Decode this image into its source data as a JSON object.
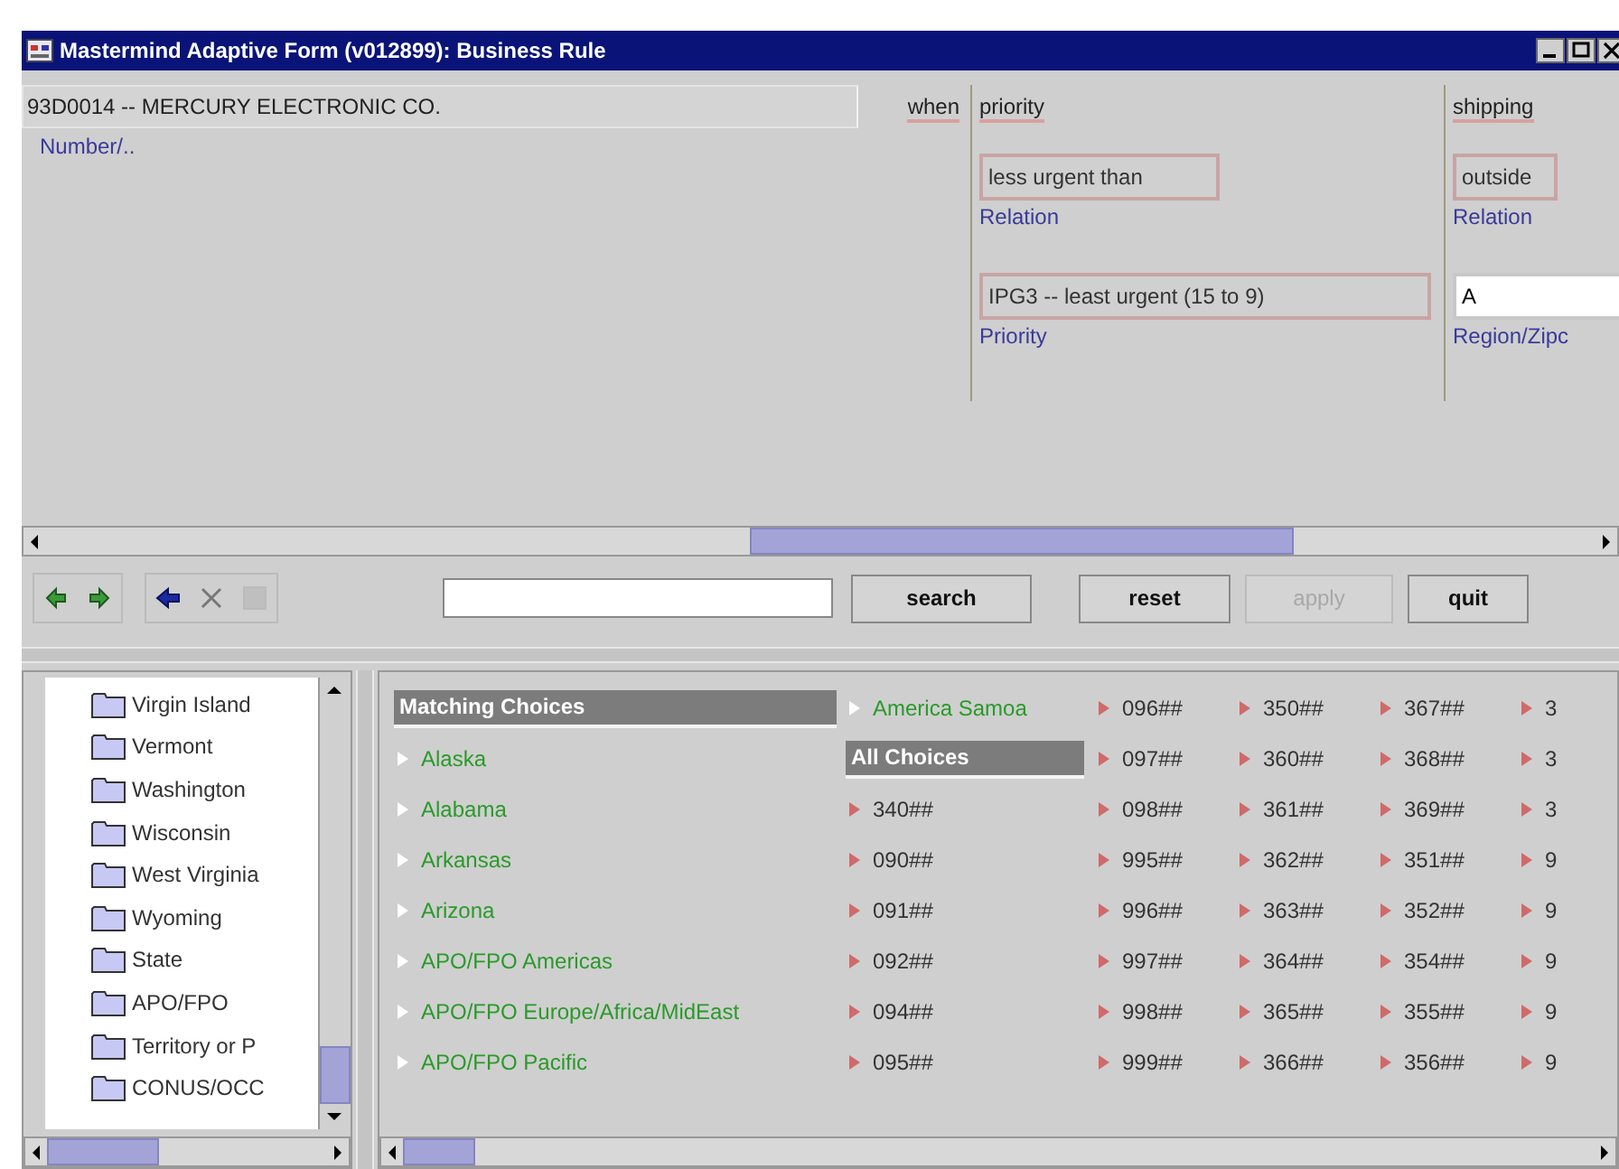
{
  "window": {
    "title": "Mastermind Adaptive Form (v012899): Business Rule"
  },
  "customer": {
    "value": "93D0014 -- MERCURY ELECTRONIC CO.",
    "label": "Number/.."
  },
  "when_label": "when",
  "criteria": [
    {
      "heading": "priority",
      "fields": [
        {
          "value": "less urgent than",
          "label": "Relation",
          "editable": false
        },
        {
          "value": "IPG3 -- least urgent (15 to 9)",
          "label": "Priority",
          "editable": false
        }
      ]
    },
    {
      "heading": "shipping",
      "fields": [
        {
          "value": "outside",
          "label": "Relation",
          "editable": false
        },
        {
          "value": "A",
          "label": "Region/Zipc",
          "editable": true
        }
      ]
    }
  ],
  "toolbar": [
    {
      "kind": "back",
      "disabled": false
    },
    {
      "kind": "forward",
      "disabled": false
    },
    {
      "kind": "left",
      "disabled": false
    },
    {
      "kind": "delete",
      "disabled": false
    },
    {
      "kind": "square",
      "disabled": true
    }
  ],
  "buttons": [
    {
      "label": "search",
      "disabled": false
    },
    {
      "label": "reset",
      "disabled": false
    },
    {
      "label": "apply",
      "disabled": true
    },
    {
      "label": "quit",
      "disabled": false
    }
  ],
  "tree": {
    "items": [
      "Virgin Island",
      "Vermont",
      "Washington",
      "Wisconsin",
      "West Virginia",
      "Wyoming",
      "State",
      "APO/FPO",
      "Territory or P",
      "CONUS/OCC"
    ]
  },
  "choices": [
    [
      {
        "kind": "header",
        "text": "Matching Choices"
      },
      {
        "kind": "match",
        "text": "Alaska"
      },
      {
        "kind": "match",
        "text": "Alabama"
      },
      {
        "kind": "match",
        "text": "Arkansas"
      },
      {
        "kind": "match",
        "text": "Arizona"
      },
      {
        "kind": "match",
        "text": "APO/FPO Americas"
      },
      {
        "kind": "match",
        "text": "APO/FPO Europe/Africa/MidEast"
      },
      {
        "kind": "match",
        "text": "APO/FPO Pacific"
      }
    ],
    [
      {
        "kind": "match",
        "text": "America Samoa"
      },
      {
        "kind": "header",
        "text": "All Choices"
      },
      {
        "kind": "code",
        "text": "340##"
      },
      {
        "kind": "code",
        "text": "090##"
      },
      {
        "kind": "code",
        "text": "091##"
      },
      {
        "kind": "code",
        "text": "092##"
      },
      {
        "kind": "code",
        "text": "094##"
      },
      {
        "kind": "code",
        "text": "095##"
      }
    ],
    [
      {
        "kind": "code",
        "text": "096##"
      },
      {
        "kind": "code",
        "text": "097##"
      },
      {
        "kind": "code",
        "text": "098##"
      },
      {
        "kind": "code",
        "text": "995##"
      },
      {
        "kind": "code",
        "text": "996##"
      },
      {
        "kind": "code",
        "text": "997##"
      },
      {
        "kind": "code",
        "text": "998##"
      },
      {
        "kind": "code",
        "text": "999##"
      }
    ],
    [
      {
        "kind": "code",
        "text": "350##"
      },
      {
        "kind": "code",
        "text": "360##"
      },
      {
        "kind": "code",
        "text": "361##"
      },
      {
        "kind": "code",
        "text": "362##"
      },
      {
        "kind": "code",
        "text": "363##"
      },
      {
        "kind": "code",
        "text": "364##"
      },
      {
        "kind": "code",
        "text": "365##"
      },
      {
        "kind": "code",
        "text": "366##"
      }
    ],
    [
      {
        "kind": "code",
        "text": "367##"
      },
      {
        "kind": "code",
        "text": "368##"
      },
      {
        "kind": "code",
        "text": "369##"
      },
      {
        "kind": "code",
        "text": "351##"
      },
      {
        "kind": "code",
        "text": "352##"
      },
      {
        "kind": "code",
        "text": "354##"
      },
      {
        "kind": "code",
        "text": "355##"
      },
      {
        "kind": "code",
        "text": "356##"
      }
    ],
    [
      {
        "kind": "code",
        "text": "3"
      },
      {
        "kind": "code",
        "text": "3"
      },
      {
        "kind": "code",
        "text": "3"
      },
      {
        "kind": "code",
        "text": "9"
      },
      {
        "kind": "code",
        "text": "9"
      },
      {
        "kind": "code",
        "text": "9"
      },
      {
        "kind": "code",
        "text": "9"
      },
      {
        "kind": "code",
        "text": "9"
      }
    ]
  ]
}
